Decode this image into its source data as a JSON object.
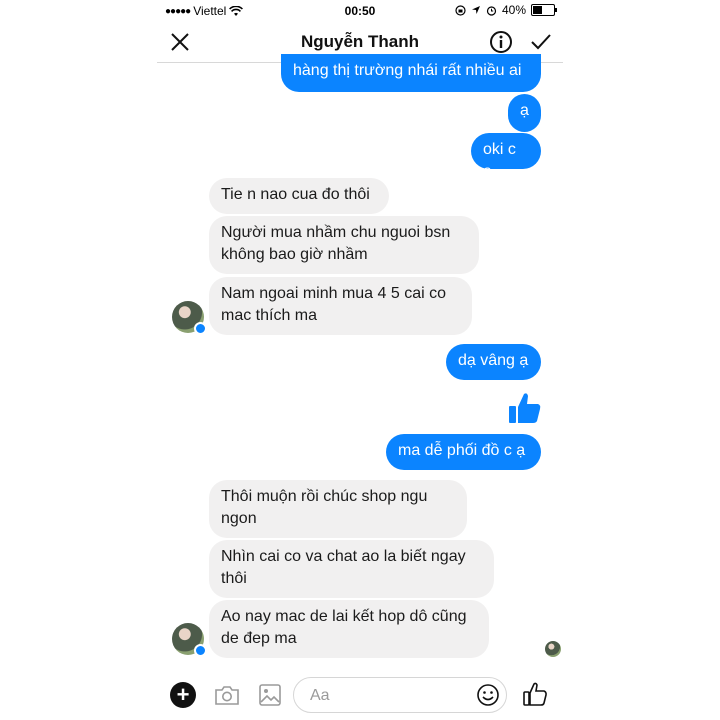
{
  "status_bar": {
    "signal": "●●●●●",
    "carrier": "Viettel",
    "time": "00:50",
    "battery": "40%"
  },
  "header": {
    "title": "Nguyễn Thanh",
    "close_icon": "close-icon",
    "info_icon": "info-icon",
    "check_icon": "checkmark-icon"
  },
  "messages": [
    {
      "from": "me",
      "text": "hàng thị trường nhái rất nhiều ai"
    },
    {
      "from": "me",
      "text": "ạ"
    },
    {
      "from": "me",
      "text": "oki c ạ"
    },
    {
      "from": "them",
      "text": "Tie n nao cua đo thôi"
    },
    {
      "from": "them",
      "text": "Người  mua nhầm  chu nguoi bsn\nkhông bao giờ  nhầm"
    },
    {
      "from": "them",
      "text": "Nam ngoai minh mua 4  5 cai co\nmac thích  ma"
    },
    {
      "from": "me",
      "text": "dạ vâng ạ"
    },
    {
      "from": "me",
      "sticker": "thumbs-up-icon"
    },
    {
      "from": "me",
      "text": "ma dễ phối đồ c ạ"
    },
    {
      "from": "them",
      "text": "Thôi  muộn  rồi  chúc  shop ngu\nngon"
    },
    {
      "from": "them",
      "text": "Nhìn  cai co va chat ao la biết  ngay\nthôi"
    },
    {
      "from": "them",
      "text": "Ao nay mac de lai kết hop dô cũng\nde đep ma"
    }
  ],
  "composer": {
    "placeholder": "Aa",
    "value": ""
  },
  "colors": {
    "outgoing_bubble": "#0b84ff",
    "incoming_bubble": "#f1f0f0",
    "accent": "#0b84ff"
  }
}
